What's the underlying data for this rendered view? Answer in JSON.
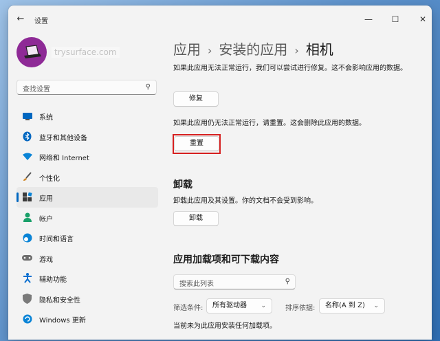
{
  "window": {
    "title": "设置",
    "controls": {
      "minimize": "—",
      "maximize": "☐",
      "close": "✕"
    }
  },
  "user": {
    "name": "trysurface.com"
  },
  "search": {
    "placeholder": "查找设置"
  },
  "sidebar": {
    "items": [
      {
        "label": "系统",
        "icon": "system-icon",
        "color": "#0067c0"
      },
      {
        "label": "蓝牙和其他设备",
        "icon": "bluetooth-icon",
        "color": "#0067c0"
      },
      {
        "label": "网络和 Internet",
        "icon": "wifi-icon",
        "color": "#0a84d6"
      },
      {
        "label": "个性化",
        "icon": "brush-icon",
        "color": "#d08a2e"
      },
      {
        "label": "应用",
        "icon": "apps-icon",
        "color": "#2a5a8a",
        "active": true
      },
      {
        "label": "帐户",
        "icon": "account-icon",
        "color": "#1aa06a"
      },
      {
        "label": "时间和语言",
        "icon": "clock-globe-icon",
        "color": "#0a84d6"
      },
      {
        "label": "游戏",
        "icon": "gamepad-icon",
        "color": "#6d6d6d"
      },
      {
        "label": "辅助功能",
        "icon": "accessibility-icon",
        "color": "#0a6fd0"
      },
      {
        "label": "隐私和安全性",
        "icon": "shield-icon",
        "color": "#7a7a7a"
      },
      {
        "label": "Windows 更新",
        "icon": "update-icon",
        "color": "#0a84d6"
      }
    ]
  },
  "breadcrumb": {
    "part1": "应用",
    "part2": "安装的应用",
    "current": "相机",
    "separator": "›"
  },
  "repair": {
    "description": "如果此应用无法正常运行，我们可以尝试进行修复。这不会影响应用的数据。",
    "button": "修复"
  },
  "reset": {
    "description": "如果此应用仍无法正常运行，请重置。这会删除此应用的数据。",
    "button": "重置"
  },
  "uninstall": {
    "heading": "卸载",
    "description": "卸载此应用及其设置。你的文档不会受到影响。",
    "button": "卸载"
  },
  "addons": {
    "heading": "应用加载项和可下载内容",
    "search_placeholder": "搜索此列表",
    "filter_label": "筛选条件:",
    "filter_value": "所有驱动器",
    "sort_label": "排序依据:",
    "sort_value": "名称(A 到 Z)",
    "empty_message": "当前未为此应用安装任何加载项。"
  },
  "colors": {
    "accent": "#0067c0",
    "highlight": "#d62020",
    "avatar": "#8e2a96"
  }
}
